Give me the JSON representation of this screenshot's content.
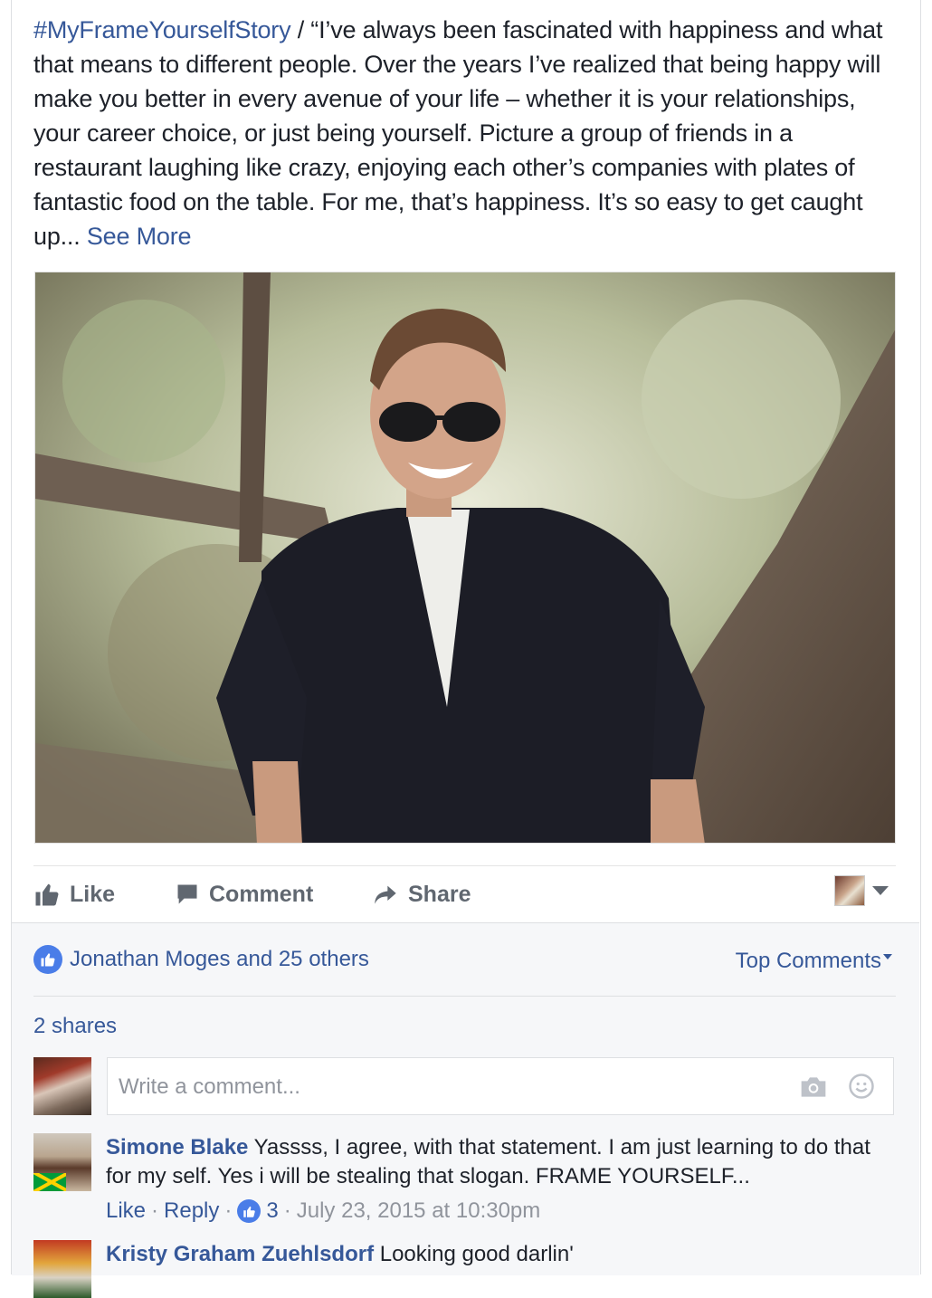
{
  "post": {
    "hashtag": "#MyFrameYourselfStory",
    "text": " / “I’ve always been fascinated with happiness and what that means to different people. Over the years I’ve realized that being happy will make you better in every avenue of your life – whether it is your relationships, your career choice, or just being yourself. Picture a group of friends in a restaurant laughing like crazy, enjoying each other’s companies with plates of fantastic food on the table. For me, that’s happiness. It’s so easy to get caught up... ",
    "see_more": "See More"
  },
  "actions": {
    "like": "Like",
    "comment": "Comment",
    "share": "Share"
  },
  "reactions": {
    "likes_text": "Jonathan Moges and 25 others",
    "top_comments": "Top Comments",
    "shares": "2 shares"
  },
  "composer": {
    "placeholder": "Write a comment..."
  },
  "comments": [
    {
      "author": "Simone Blake",
      "text": " Yassss, I agree, with that statement. I am just learning to do that for my self. Yes i will be stealing that slogan. FRAME YOURSELF...",
      "like": "Like",
      "reply": "Reply",
      "likes": "3",
      "time": "July 23, 2015 at 10:30pm"
    },
    {
      "author": "Kristy Graham Zuehlsdorf",
      "text": " Looking good darlin'"
    }
  ],
  "colors": {
    "link": "#365899",
    "like_blue": "#4a7de8",
    "meta": "#90949c"
  },
  "icons": [
    "like-thumb-icon",
    "comment-bubble-icon",
    "share-arrow-icon",
    "dropdown-caret-icon",
    "camera-icon",
    "smiley-icon"
  ]
}
